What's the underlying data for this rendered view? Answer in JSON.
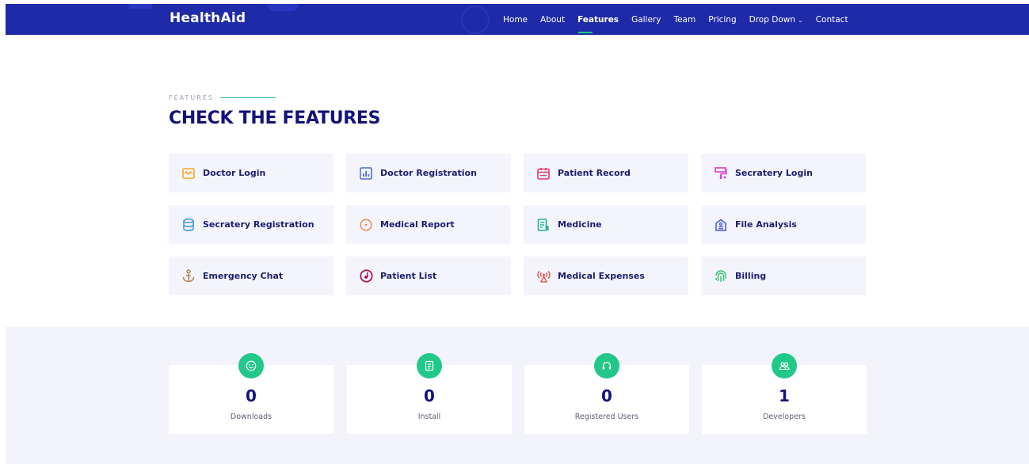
{
  "header": {
    "logo": "HealthAid",
    "nav": [
      {
        "label": "Home",
        "active": false
      },
      {
        "label": "About",
        "active": false
      },
      {
        "label": "Features",
        "active": true
      },
      {
        "label": "Gallery",
        "active": false
      },
      {
        "label": "Team",
        "active": false
      },
      {
        "label": "Pricing",
        "active": false
      },
      {
        "label": "Drop Down",
        "active": false,
        "dropdown": true
      },
      {
        "label": "Contact",
        "active": false
      }
    ]
  },
  "features": {
    "subtitle": "FEATURES",
    "title": "CHECK THE FEATURES",
    "items": [
      {
        "label": "Doctor Login",
        "icon": "chart-window-icon",
        "color": "#f7a823"
      },
      {
        "label": "Doctor Registration",
        "icon": "bar-chart-icon",
        "color": "#4b6bd8"
      },
      {
        "label": "Patient Record",
        "icon": "calendar-icon",
        "color": "#e8386b"
      },
      {
        "label": "Secratery Login",
        "icon": "paint-roller-icon",
        "color": "#d63ad1"
      },
      {
        "label": "Secratery Registration",
        "icon": "database-icon",
        "color": "#3b97e0"
      },
      {
        "label": "Medical Report",
        "icon": "gradient-circle-icon",
        "color": "#f28b4b"
      },
      {
        "label": "Medicine",
        "icon": "document-icon",
        "color": "#26b38d"
      },
      {
        "label": "File Analysis",
        "icon": "house-document-icon",
        "color": "#4755d4"
      },
      {
        "label": "Emergency Chat",
        "icon": "anchor-icon",
        "color": "#b08751"
      },
      {
        "label": "Patient List",
        "icon": "disc-icon",
        "color": "#b01459"
      },
      {
        "label": "Medical Expenses",
        "icon": "broadcast-icon",
        "color": "#ee3e3e"
      },
      {
        "label": "Billing",
        "icon": "fingerprint-icon",
        "color": "#27c46a"
      }
    ]
  },
  "stats": [
    {
      "value": "0",
      "label": "Downloads",
      "icon": "smile-icon"
    },
    {
      "value": "0",
      "label": "Install",
      "icon": "document-icon"
    },
    {
      "value": "0",
      "label": "Registered Users",
      "icon": "headphones-icon"
    },
    {
      "value": "1",
      "label": "Developers",
      "icon": "people-icon"
    }
  ]
}
